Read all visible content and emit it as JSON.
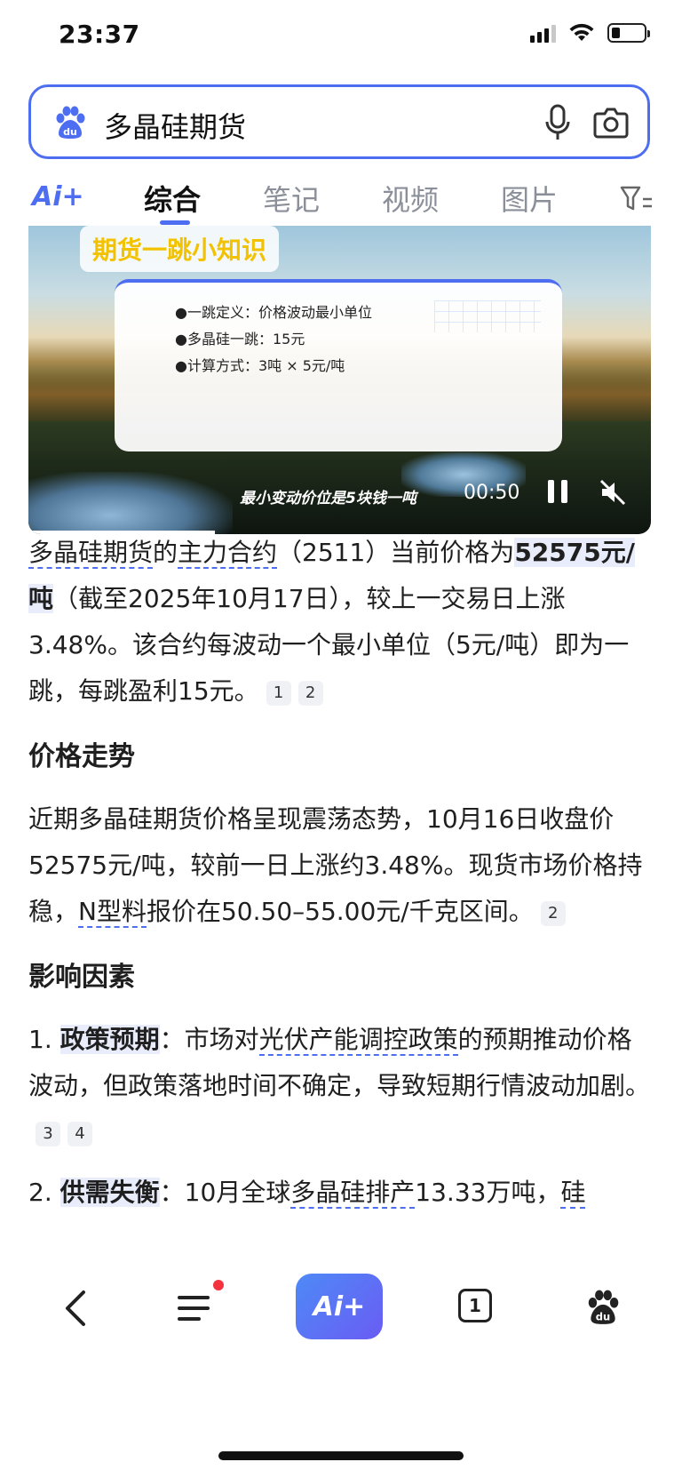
{
  "status_bar": {
    "time": "23:37"
  },
  "search": {
    "query": "多晶硅期货"
  },
  "tabs": {
    "ai_label": "Ai+",
    "items": [
      {
        "label": "综合",
        "active": true
      },
      {
        "label": "笔记",
        "active": false
      },
      {
        "label": "视频",
        "active": false
      },
      {
        "label": "图片",
        "active": false
      }
    ]
  },
  "video": {
    "title": "期货一跳小知识",
    "card_lines": [
      "●一跳定义：价格波动最小单位",
      "●多晶硅一跳：15元",
      "●计算方式：3吨 × 5元/吨"
    ],
    "subtitle": "最小变动价位是5块钱一吨",
    "time": "00:50"
  },
  "article": {
    "intro": {
      "p1_link1": "多晶硅期货",
      "p1_t1": "的",
      "p1_link2": "主力合约",
      "p1_t2": "（2511）当前价格为",
      "p1_hl": "52575元/吨",
      "p1_t3": "（截至2025年10月17日），较上一交易日上涨3.48%。该合约每波动一个最小单位（5元/吨）即为一跳，每跳盈利15元。",
      "cite1": "1",
      "cite2": "2"
    },
    "section1": {
      "heading": "价格走势",
      "t1": "近期多晶硅期货价格呈现震荡态势，10月16日收盘价52575元/吨，较前一日上涨约3.48%。现货市场价格持稳，",
      "link": "N型料",
      "t2": "报价在50.50–55.00元/千克区间。",
      "cite": "2"
    },
    "section2": {
      "heading": "影响因素",
      "item1_num": "1.",
      "item1_hl": "政策预期",
      "item1_t1": "：市场对",
      "item1_link": "光伏产能调控政策",
      "item1_t2": "的预期推动价格波动，但政策落地时间不确定，导致短期行情波动加剧。",
      "item1_cite1": "3",
      "item1_cite2": "4",
      "item2_num": "2.",
      "item2_hl": "供需失衡",
      "item2_t1": "：10月全球",
      "item2_link1": "多晶硅排产",
      "item2_t2": "13.33万吨，",
      "item2_link2": "硅"
    }
  },
  "bottom_nav": {
    "ai_label": "Ai+",
    "tab_count": "1"
  }
}
